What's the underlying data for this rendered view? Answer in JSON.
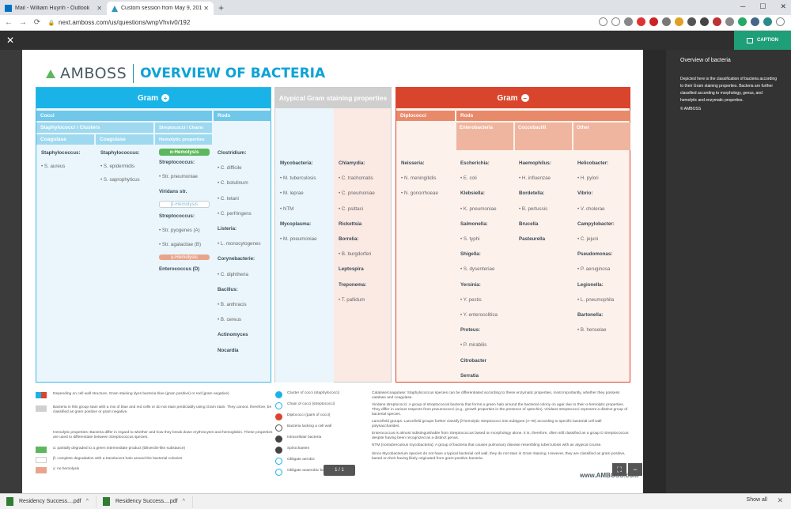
{
  "browser": {
    "tabs": [
      {
        "title": "Mail - William Huynh - Outlook",
        "active": false
      },
      {
        "title": "Custom session from May 9, 201",
        "active": true
      }
    ],
    "url": "next.amboss.com/us/questions/wnpVhviv0/192"
  },
  "viewer": {
    "caption_label": "CAPTION",
    "page_indicator": "1 / 1"
  },
  "side_panel": {
    "title": "Overview of bacteria",
    "description": "Depicted here is the classification of bacteria according to their Gram staining properties. Bacteria are further classified according to morphology, genus, and hemolytic and enzymatic properties.",
    "copyright": "© AMBOSS"
  },
  "document": {
    "logo": "AMBOSS",
    "title": "OVERVIEW OF BACTERIA",
    "footer": "www.AMBOSS.com",
    "gram_pos": {
      "header": "Gram",
      "cocci": "Cocci",
      "rods": "Rods",
      "staph_cluster": "Staphylococci / Clusters",
      "strep_chain": "Streptococci / Chains",
      "coag_pos": "Coagulase",
      "coag_neg": "Coagulase",
      "hemolytic": "Hemolytic properties",
      "c1": [
        "Staphylococcus:",
        "• S. aureus"
      ],
      "c2": [
        "Staphylococcus:",
        "• S. epidermidis",
        "• S. saprophyticus"
      ],
      "alpha": "α-Hemolysis",
      "c3": [
        "Streptococcus:",
        "• Str. pneumoniae",
        "Viridans str.",
        "β-Hemolysis",
        "Streptococcus:",
        "• Str. pyogenes (A)",
        "• Str. agalactiae (B)",
        "γ-Hemolysis",
        "Enterococcus (D)"
      ],
      "c4": [
        "Clostridium:",
        "• C. difficile",
        "• C. botulinum",
        "• C. tetani",
        "• C. perfringens",
        "Listeria:",
        "• L. monocytogenes",
        "Corynebacterie:",
        "• C. diphtheria",
        "Bacillus:",
        "• B. anthracis",
        "• B. cereus",
        "Actinomyces",
        "Nocardia"
      ]
    },
    "atypical": {
      "header": "Atypical Gram staining properties",
      "c1": [
        "Mycobacteria:",
        "• M. tuberculosis",
        "• M. leprae",
        "• NTM",
        "Mycoplasma:",
        "• M. pneumoniae"
      ],
      "c2": [
        "Chlamydia:",
        "• C. trachomatis",
        "• C. pneumoniae",
        "• C. psittaci",
        "Rickettsia",
        "Borrelia:",
        "• B. burgdorferi",
        "Leptospira",
        "Treponema:",
        "• T. pallidum"
      ]
    },
    "gram_neg": {
      "header": "Gram",
      "diplococci": "Diplococci",
      "rods": "Rods",
      "entero": "Enterobacteria",
      "cocco": "Coccobacilli",
      "other": "Other",
      "c1": [
        "Neisseria:",
        "• N. meningitidis",
        "• N. gonorrhoeae"
      ],
      "c2": [
        "Escherichia:",
        "• E. coli",
        "Klebsiella:",
        "• K. pneumoniae",
        "Salmonella:",
        "• S. typhi",
        "Shigella:",
        "• S. dysenteriae",
        "Yersinia:",
        "• Y. pestis",
        "• Y. enterocolitica",
        "Proteus:",
        "• P. mirabilis",
        "Citrobacter",
        "Serratia"
      ],
      "c3": [
        "Haemophilus:",
        "• H. influenzae",
        "Bordetella:",
        "• B. pertussis",
        "Brucella",
        "Pasteurella"
      ],
      "c4": [
        "Helicobacter:",
        "• H. pylori",
        "Vibrio:",
        "• V. cholerae",
        "Campylobacter:",
        "• C. jejuni",
        "Pseudomonas:",
        "• P. aeruginosa",
        "Legionella:",
        "• L. pneumophila",
        "Bartonella:",
        "• B. henselae"
      ]
    },
    "legend": {
      "l1": "Depending on cell wall structure, Gram staining dyes bacteria blue (gram positive) or red (gram negative)",
      "l2": "Bacteria in this group stain with a mix of blue and red cells or do not stain predictably using Gram stain. They cannot, therefore, be classified as gram positive or gram negative.",
      "l3": "Hemolytic properties: Bacteria differ in regard to whether and how they break down erythrocytes and hemoglobin. These properties are used to differentiate between Streptococcus species.",
      "l4": "α: partially degraded to a green intermediate product (biliverdin-like substance)",
      "l5": "β: complete degradation with a translucent halo around the bacterial colonies",
      "l6": "γ: no hemolysis",
      "m1": "Cluster of cocci (staphylococci)",
      "m2": "Chain of cocci (streptococci)",
      "m3": "Diplococci (pairs of cocci)",
      "m4": "Bacteria lacking a cell wall",
      "m5": "Intracellular bacteria",
      "m6": "Spirochaetes",
      "m7": "Obligate aerobic",
      "m8": "Obligate anaerobic bacteria",
      "n1": "Catalase/coagulase: Staphylococcus species can be differentiated according to these enzymatic properties, most importantly, whether they possess catalase and coagulase.",
      "n2": "Viridans streptococci: A group of streptococcal bacteria that forms a green halo around the bacterial colony on agar due to their α-hemolytic properties. They differ in various respects from pneumococci (e.g., growth properties in the presence of optochin). Viridans streptococci represent a distinct group of bacterial species.",
      "n3": "Lancefield groups: Lancefield groups further classify β-hemolytic streptococci into subtypes (A–W) according to specific bacterial cell wall polysaccharides.",
      "n4": "Enterococcus is almost indistinguishable from Streptococcus based on morphology alone. It is, therefore, often still classified as a group D Streptococcus despite having been recognized as a distinct genus.",
      "n5": "NTM (nontuberculous mycobacteria): A group of bacteria that causes pulmonary disease resembling tuberculosis with an atypical course.",
      "n6": "Since Mycobacterium species do not have a typical bacterial cell wall, they do not stain in Gram staining. However, they are classified as gram positive, based on their having likely originated from gram-positive bacteria."
    }
  },
  "downloads": [
    {
      "name": "Residency Success....pdf"
    },
    {
      "name": "Residency Success....pdf"
    }
  ],
  "show_all": "Show all"
}
